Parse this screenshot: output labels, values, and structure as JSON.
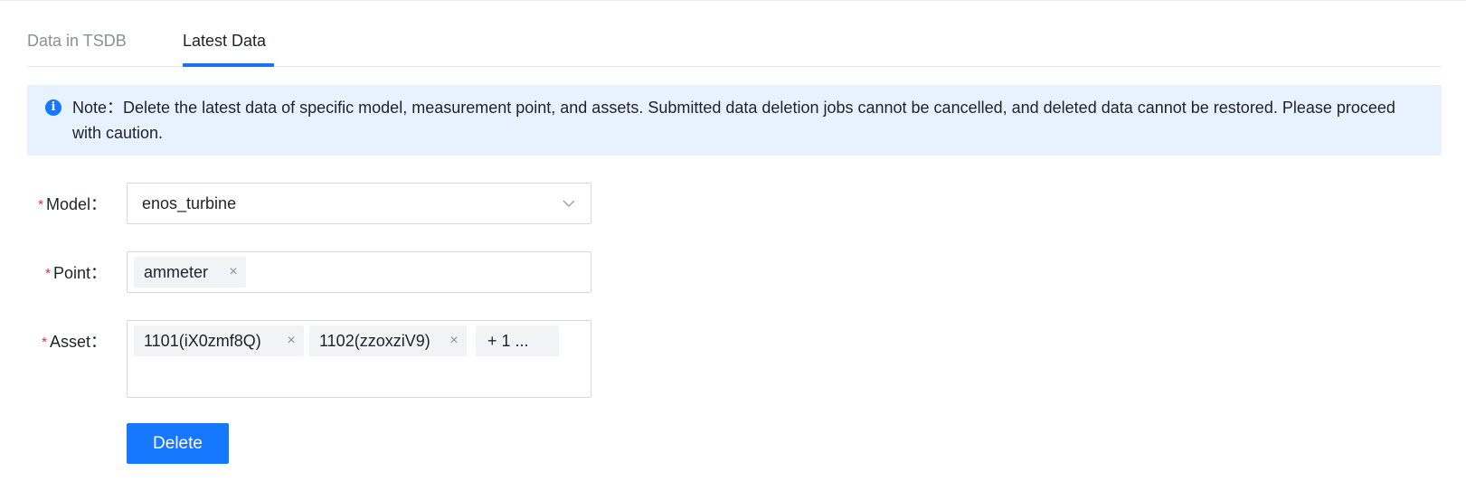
{
  "tabs": [
    {
      "label": "Data in TSDB",
      "active": false
    },
    {
      "label": "Latest Data",
      "active": true
    }
  ],
  "note": {
    "icon": "info-icon",
    "text": "Note：Delete the latest data of specific model, measurement point, and assets. Submitted data deletion jobs cannot be cancelled, and deleted data cannot be restored. Please proceed with caution."
  },
  "form": {
    "required_mark": "*",
    "model": {
      "label": "Model：",
      "value": "enos_turbine",
      "icon": "chevron-down-icon"
    },
    "point": {
      "label": "Point：",
      "tags": [
        "ammeter"
      ]
    },
    "asset": {
      "label": "Asset：",
      "tags": [
        "1101(iX0zmf8Q)",
        "1102(zzoxziV9)"
      ],
      "more_label": "+ 1 ..."
    },
    "close_glyph": "×"
  },
  "actions": {
    "delete_label": "Delete"
  },
  "colors": {
    "accent": "#1677ff",
    "tab_underline": "#1a73e8",
    "note_background": "#e8f2fe",
    "required": "#f5222d",
    "tag_background": "#f2f3f5"
  }
}
